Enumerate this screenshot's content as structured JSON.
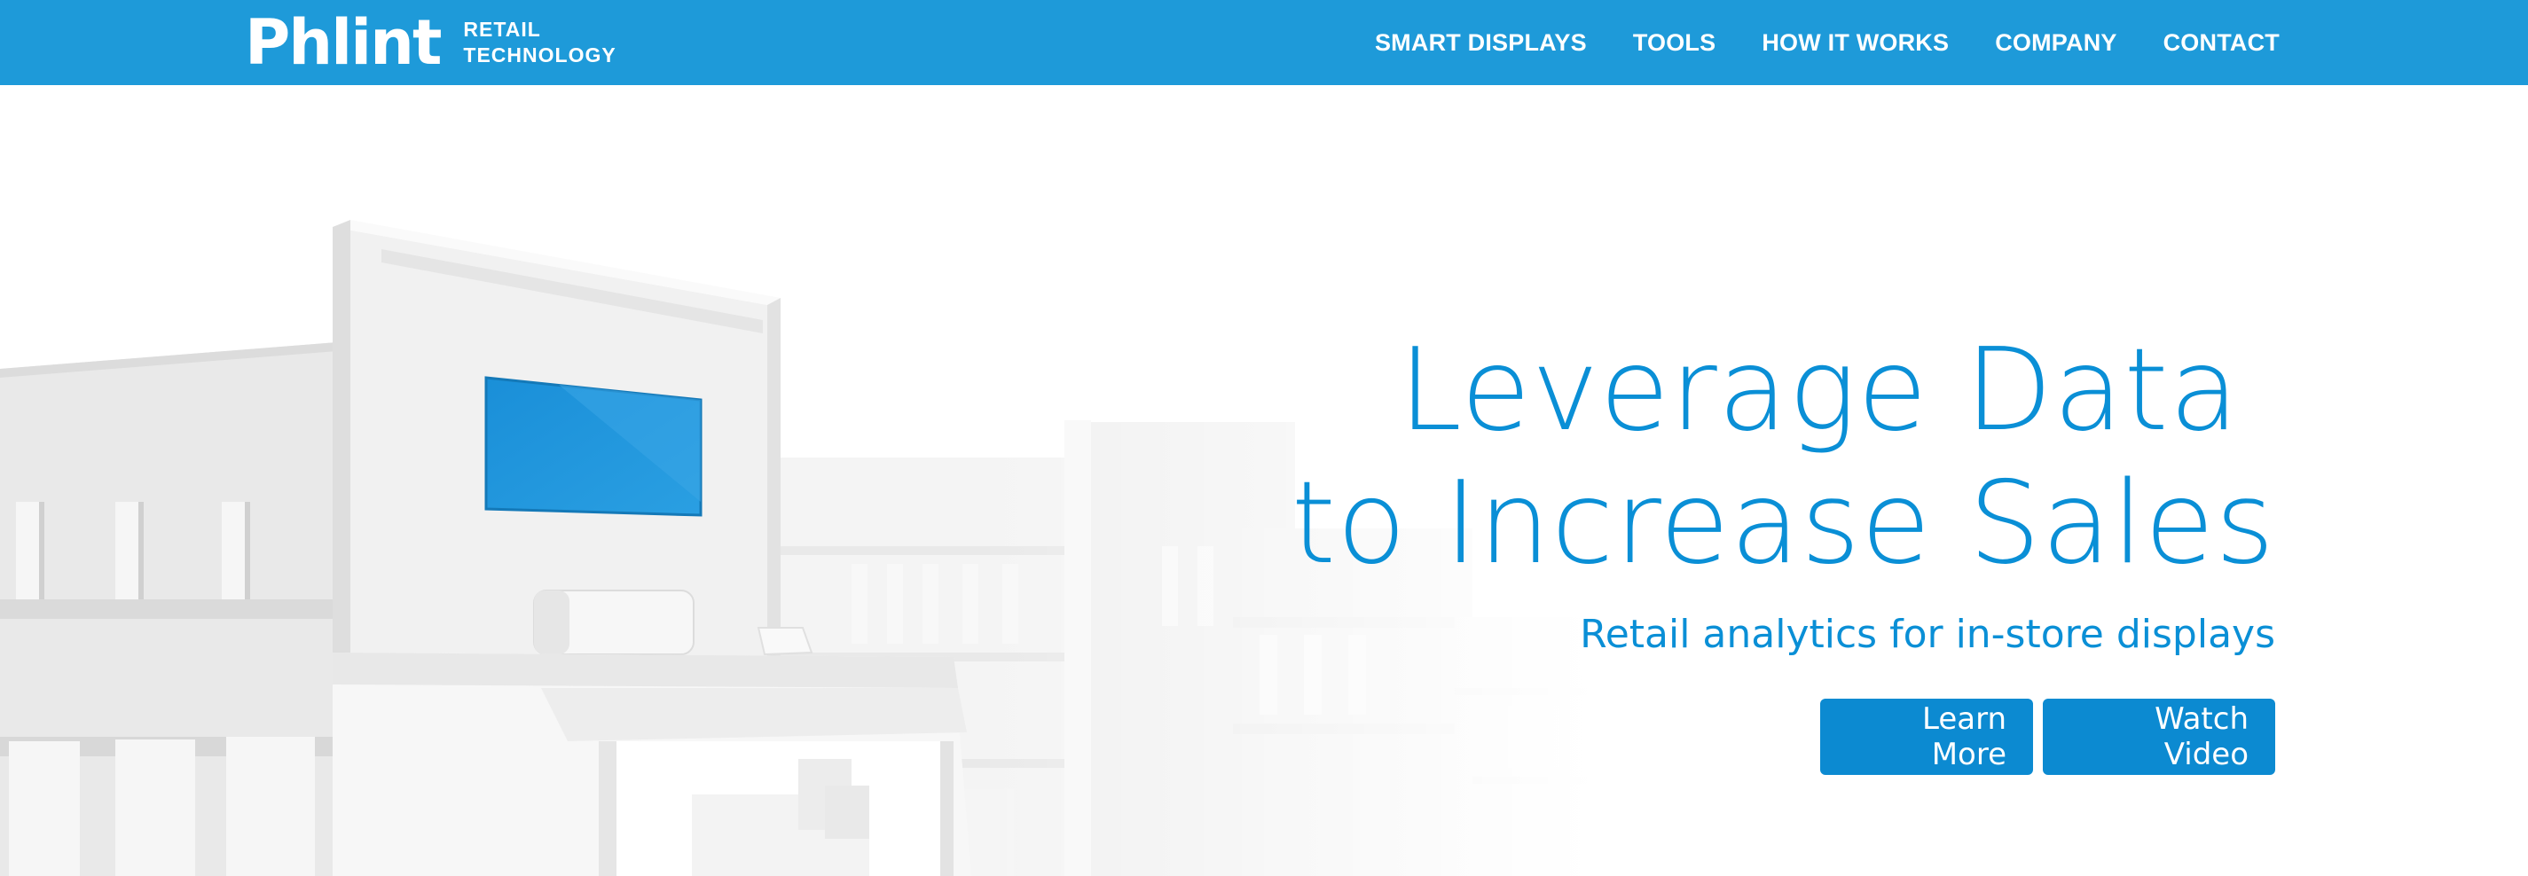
{
  "brand": {
    "name": "Phlint",
    "tagline_line1": "RETAIL",
    "tagline_line2": "TECHNOLOGY"
  },
  "nav": {
    "items": [
      {
        "label": "SMART DISPLAYS"
      },
      {
        "label": "TOOLS"
      },
      {
        "label": "HOW IT WORKS"
      },
      {
        "label": "COMPANY"
      },
      {
        "label": "CONTACT"
      }
    ]
  },
  "hero": {
    "headline_line1": "Leverage Data",
    "headline_line2": "to Increase Sales",
    "subheadline": "Retail analytics for in-store displays",
    "primary_button": "Learn More",
    "secondary_button": "Watch Video"
  },
  "colors": {
    "nav_background": "#1e9ad9",
    "accent_text": "#0a8fd6",
    "button": "#0c8ad1",
    "screen_blue": "#1a8fd8"
  }
}
